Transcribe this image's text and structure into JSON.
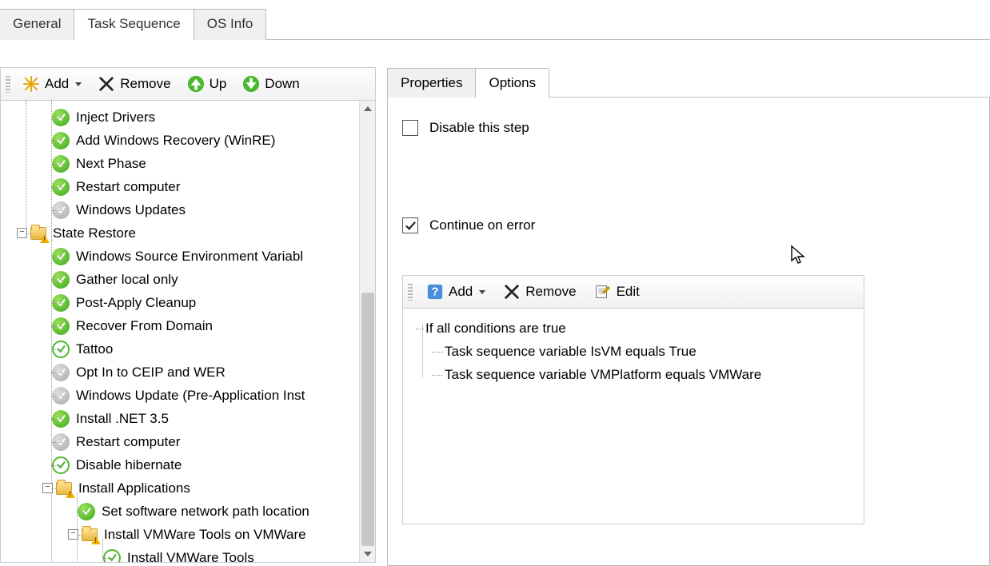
{
  "topTabs": {
    "general": "General",
    "taskSequence": "Task Sequence",
    "osInfo": "OS Info"
  },
  "toolbar": {
    "add": "Add",
    "remove": "Remove",
    "up": "Up",
    "down": "Down"
  },
  "tree": {
    "items": [
      {
        "label": "Inject Drivers",
        "status": "green"
      },
      {
        "label": "Add Windows Recovery (WinRE)",
        "status": "green"
      },
      {
        "label": "Next Phase",
        "status": "green"
      },
      {
        "label": "Restart computer",
        "status": "green"
      },
      {
        "label": "Windows Updates",
        "status": "grey"
      }
    ],
    "stateRestore": "State Restore",
    "restoreItems": [
      {
        "label": "Windows Source Environment Variabl",
        "status": "green"
      },
      {
        "label": "Gather local only",
        "status": "green"
      },
      {
        "label": "Post-Apply Cleanup",
        "status": "green"
      },
      {
        "label": "Recover From Domain",
        "status": "green"
      },
      {
        "label": "Tattoo",
        "status": "outline"
      },
      {
        "label": "Opt In to CEIP and WER",
        "status": "grey"
      },
      {
        "label": "Windows Update (Pre-Application Inst",
        "status": "grey"
      },
      {
        "label": "Install .NET 3.5",
        "status": "green"
      },
      {
        "label": "Restart computer",
        "status": "grey"
      },
      {
        "label": "Disable hibernate",
        "status": "outline"
      }
    ],
    "installApps": "Install Applications",
    "appsItems": [
      {
        "label": "Set software network path location",
        "status": "green"
      }
    ],
    "vmwareFolder": "Install VMWare Tools on VMWare",
    "vmwareItems": [
      {
        "label": "Install VMWare Tools",
        "status": "outline"
      }
    ]
  },
  "right": {
    "tabs": {
      "properties": "Properties",
      "options": "Options"
    },
    "disableStep": "Disable this step",
    "continueErr": "Continue on error",
    "condToolbar": {
      "add": "Add",
      "remove": "Remove",
      "edit": "Edit"
    },
    "conditions": {
      "root": "If all conditions are true",
      "c1": "Task sequence variable IsVM equals True",
      "c2": "Task sequence variable VMPlatform equals VMWare"
    }
  }
}
